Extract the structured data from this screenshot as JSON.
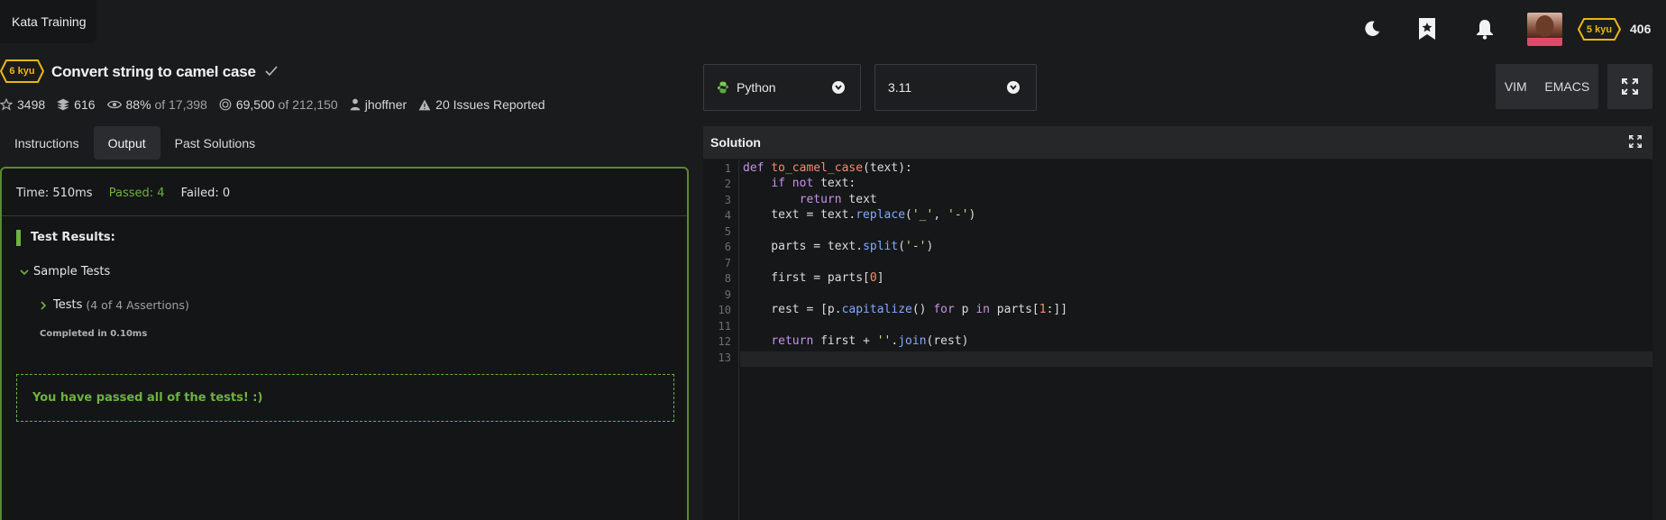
{
  "top_tab": {
    "label": "Kata Training"
  },
  "user": {
    "rank": "5 kyu",
    "honor": "406"
  },
  "kata": {
    "rank": "6 kyu",
    "title": "Convert string to camel case",
    "stats": {
      "stars": "3498",
      "collections": "616",
      "satisfaction": "88%",
      "satisfaction_of": "of 17,398",
      "completed": "69,500",
      "completed_of": "of 212,150",
      "author": "jhoffner",
      "issues": "20 Issues Reported"
    }
  },
  "tabs": [
    "Instructions",
    "Output",
    "Past Solutions"
  ],
  "output": {
    "time": "Time: 510ms",
    "passed": "Passed: 4",
    "failed": "Failed: 0",
    "results_title": "Test Results:",
    "sample_tests": "Sample Tests",
    "tests_label": "Tests",
    "assertions": "(4 of 4 Assertions)",
    "completed": "Completed in 0.10ms",
    "pass_message": "You have passed all of the tests! :)"
  },
  "editor": {
    "language": "Python",
    "version": "3.11",
    "modes": [
      "VIM",
      "EMACS"
    ],
    "panel_title": "Solution",
    "line_numbers": [
      "1",
      "2",
      "3",
      "4",
      "5",
      "6",
      "7",
      "8",
      "9",
      "10",
      "11",
      "12",
      "13"
    ],
    "code": [
      "def to_camel_case(text):",
      "    if not text:",
      "        return text",
      "    text = text.replace('_', '-')",
      "",
      "    parts = text.split('-')",
      "",
      "    first = parts[0]",
      "",
      "    rest = [p.capitalize() for p in parts[1:]]",
      "",
      "    return first + ''.join(rest)",
      ""
    ]
  },
  "colors": {
    "background": "#1a1b1d",
    "rank_yellow": "#ecb613",
    "pass_green": "#6cb33f",
    "panel_border": "#5a8a2d"
  },
  "icons": [
    "moon-icon",
    "bookmark-icon",
    "bell-icon",
    "star-icon",
    "layers-icon",
    "eye-icon",
    "target-icon",
    "user-icon",
    "warning-icon",
    "python-icon",
    "chevron-down-icon",
    "expand-icon",
    "check-icon"
  ]
}
